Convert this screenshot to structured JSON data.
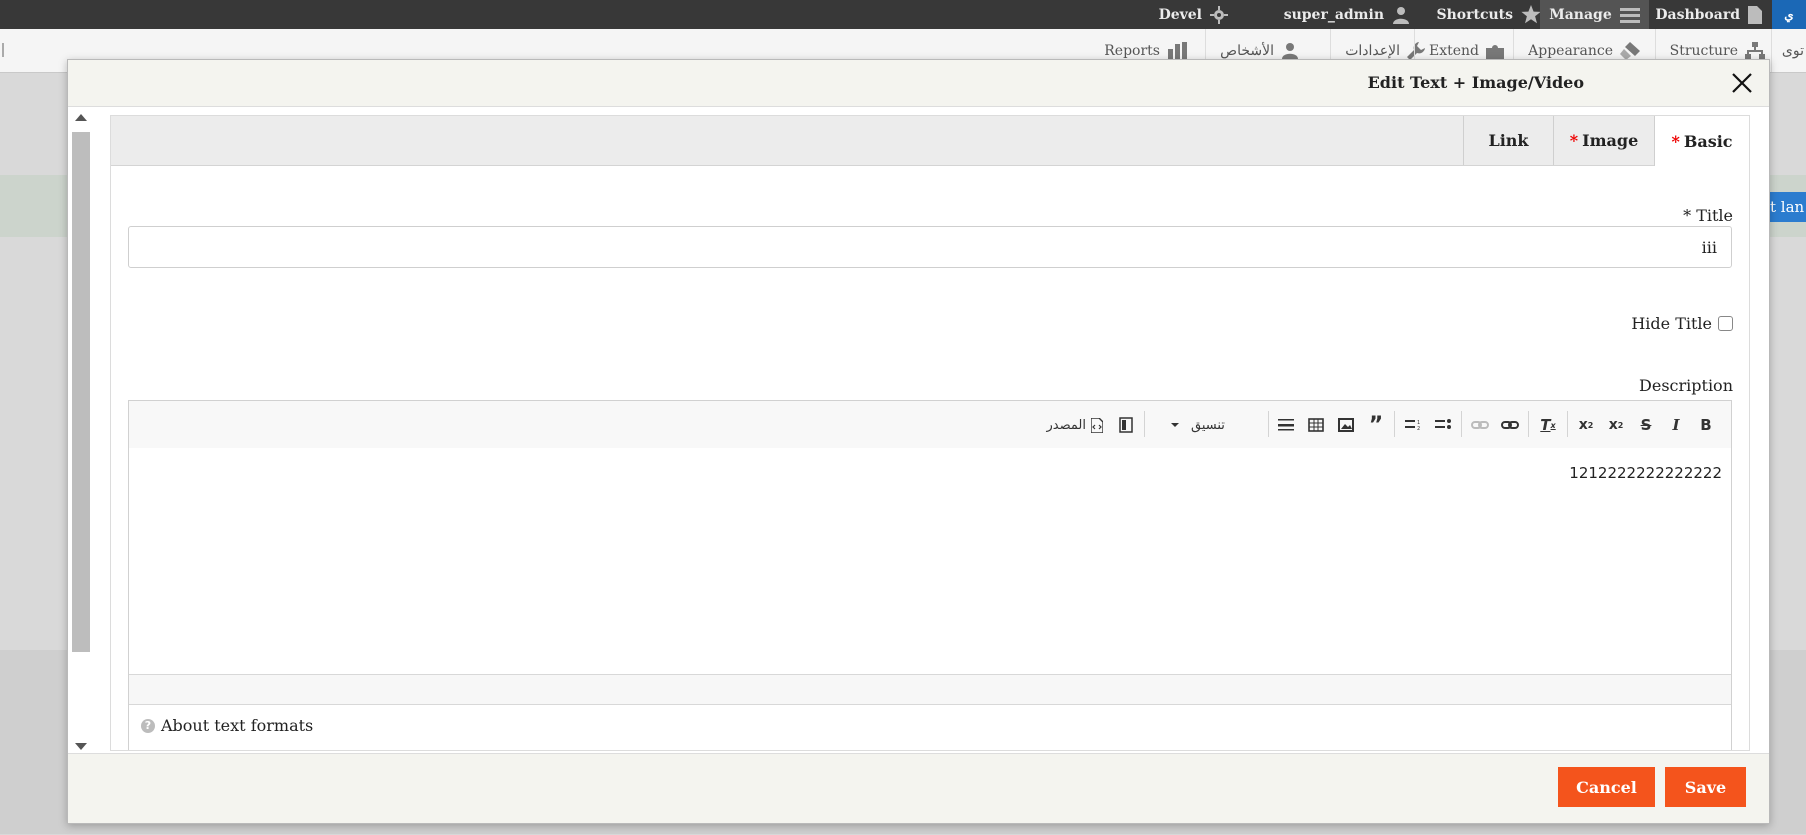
{
  "toolbar": {
    "devel": "Devel",
    "user": "super_admin",
    "shortcuts": "Shortcuts",
    "manage": "Manage",
    "dashboard": "Dashboard",
    "edge_partial": "ي"
  },
  "tray": {
    "reports": "Reports",
    "people": "الأشخاص",
    "config": "الإعدادات",
    "extend": "Extend",
    "appearance": "Appearance",
    "structure": "Structure",
    "content_partial": "توى"
  },
  "background": {
    "lang_tag_partial": "t lan"
  },
  "dialog": {
    "title": "Edit Text + Image/Video",
    "tabs": [
      {
        "label": "Basic",
        "required": "*"
      },
      {
        "label": "Image",
        "required": "*"
      },
      {
        "label": "Link",
        "required": ""
      }
    ],
    "fields": {
      "title_label": "* Title",
      "title_value": "iii",
      "hide_title_label": "Hide Title",
      "description_label": "Description",
      "description_text": "1212222222222222",
      "about_text_formats": "About text formats"
    },
    "editor_toolbar": {
      "format_label": "تنسيق",
      "source_label": "المصدر"
    },
    "buttons": {
      "save": "Save",
      "cancel": "Cancel"
    }
  },
  "colors": {
    "accent_button": "#f4541c",
    "toolbar_bg": "#383838",
    "required_marker": "#e00000"
  }
}
